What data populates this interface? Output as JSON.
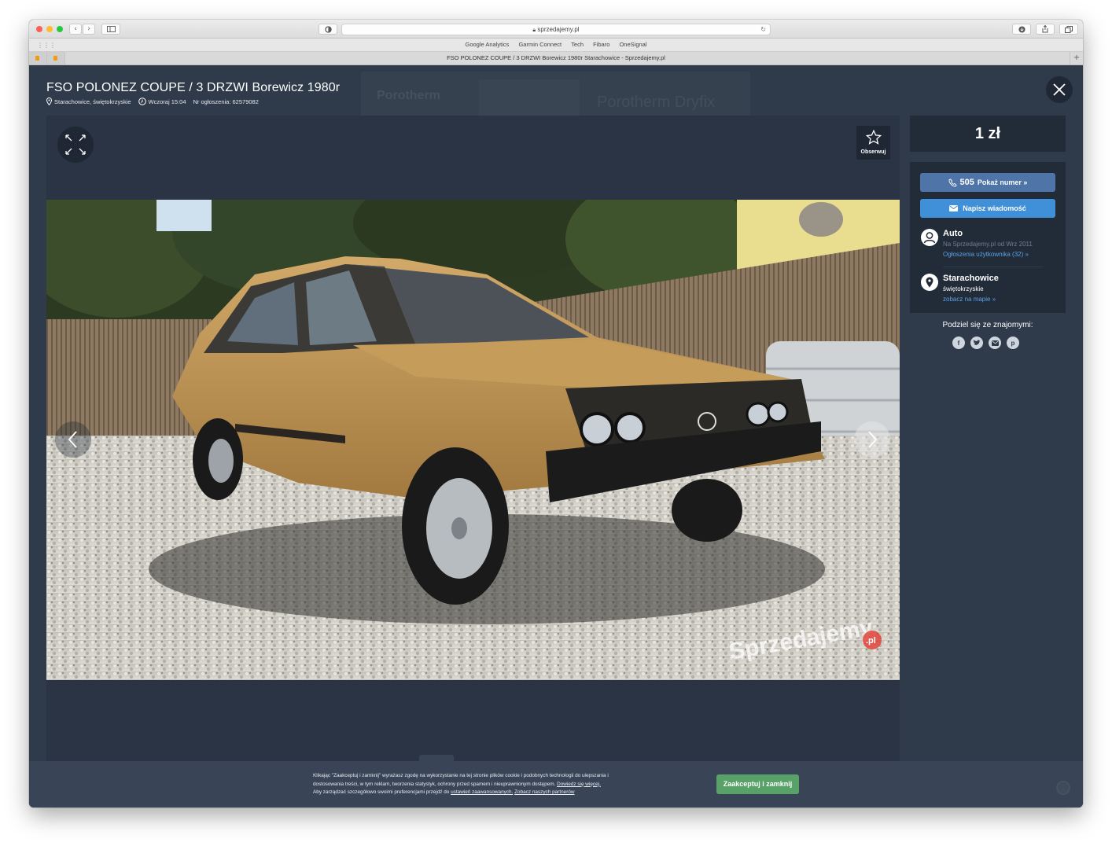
{
  "browser": {
    "url": "sprzedajemy.pl",
    "bookmarks": [
      "Google Analytics",
      "Garmin Connect",
      "Tech",
      "Fibaro",
      "OneSignal"
    ],
    "tab_title": "FSO POLONEZ COUPE / 3 DRZWI Borewicz 1980r Starachowice - Sprzedajemy.pl"
  },
  "background_ad": {
    "brand": "Porotherm",
    "product": "Porotherm Dryfix"
  },
  "listing": {
    "title": "FSO POLONEZ COUPE / 3 DRZWI Borewicz 1980r",
    "location": "Starachowice, świętokrzyskie",
    "posted": "Wczoraj 15:04",
    "ad_number": "Nr ogłoszenia: 62579082",
    "watch_label": "Obserwuj",
    "photo_watermark": "Sprzedajemy",
    "photo_watermark_badge": ".pl"
  },
  "sidebar": {
    "price": "1 zł",
    "phone_prefix": "505",
    "phone_label": "Pokaż numer »",
    "message_label": "Napisz wiadomość",
    "seller_name": "Auto",
    "seller_since": "Na Sprzedajemy.pl od Wrz 2011",
    "seller_ads": "Ogłoszenia użytkownika (32) »",
    "city": "Starachowice",
    "region": "świętokrzyskie",
    "map_link": "zobacz na mapie »",
    "share_title": "Podziel się ze znajomymi:"
  },
  "cookie": {
    "line1": "Klikając \"Zaakceptuj i zamknij\" wyrażasz zgodę na wykorzystanie na tej stronie plików cookie i podobnych technologii do ulepszania i",
    "line2": "dostosowania treści, w tym reklam, tworzenia statystyk, ochrony przed spamem i nieuprawnionym dostępem.",
    "link_more": "Dowiedz się więcej.",
    "line3": "Aby zarządzać szczegółowo swoimi preferencjami przejdź do",
    "link_settings": "ustawień zaawansowanych.",
    "link_partners": "Zobacz naszych partnerów",
    "accept_label": "Zaakceptuj i zamknij"
  },
  "colors": {
    "page_bg": "#2f3a4a",
    "panel_bg": "#222b38",
    "phone_button": "#4f74a8",
    "message_button": "#3f8fd9",
    "link": "#5aa2e6",
    "accept_button": "#58a26a"
  }
}
